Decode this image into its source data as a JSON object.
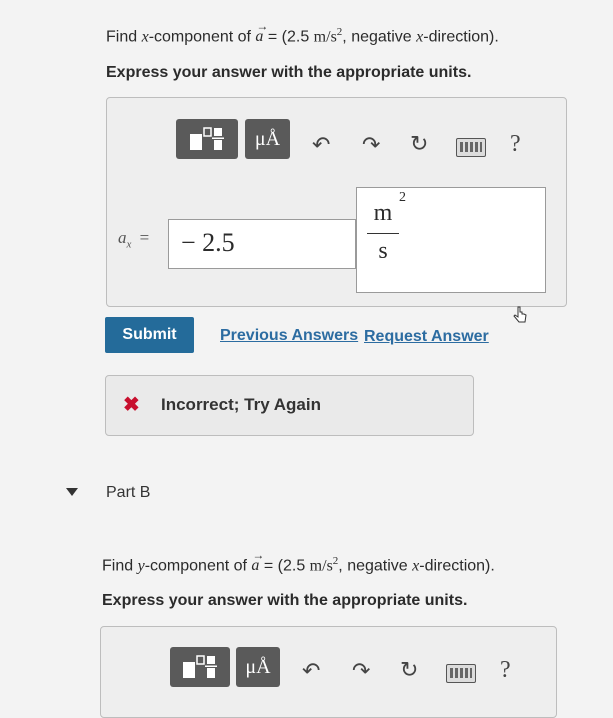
{
  "part_a": {
    "question_prefix": "Find x-component of a = (2.5 m/s², negative x-direction).",
    "find": "Find ",
    "var_x": "x",
    "component_of": "-component of ",
    "vec": "a",
    "eq_open": " = (2.5 ",
    "unit_ms": "m/s",
    "sq": "2",
    "rest": ", negative ",
    "rest_x": "x",
    "rest_end": "-direction).",
    "instruction": "Express your answer with the appropriate units.",
    "answer_label_var": "a",
    "answer_label_sub": "x",
    "answer_label_eq": "=",
    "answer_value": "− 2.5",
    "unit_numerator": "m",
    "unit_exponent": "2",
    "unit_denominator": "s",
    "submit_label": "Submit",
    "previous_answers_label": "Previous Answers",
    "request_answer_label": "Request Answer",
    "feedback_text": "Incorrect; Try Again",
    "feedback_icon": "✖"
  },
  "part_b": {
    "title": "Part B",
    "find": "Find ",
    "var_y": "y",
    "component_of": "-component of ",
    "vec": "a",
    "eq_open": " = (2.5 ",
    "unit_ms": "m/s",
    "sq": "2",
    "rest": ", negative ",
    "rest_x": "x",
    "rest_end": "-direction).",
    "instruction": "Express your answer with the appropriate units."
  },
  "toolbar": {
    "units_label": "μÅ",
    "help_label": "?"
  },
  "colors": {
    "submit_bg": "#246b9a",
    "link": "#2c6ca1",
    "error": "#c8102e"
  }
}
